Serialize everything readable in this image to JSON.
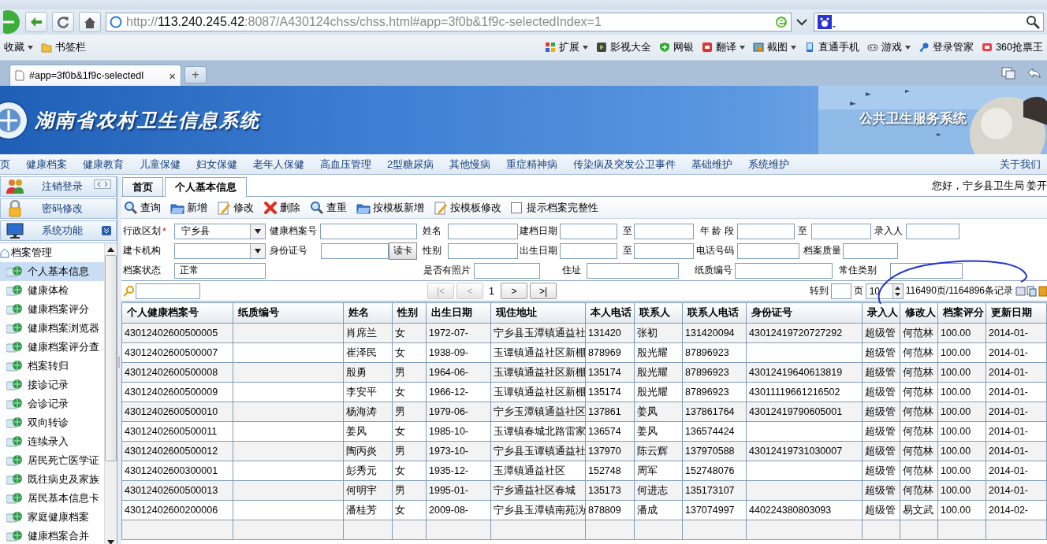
{
  "browser": {
    "url_prefix": "http://",
    "url_host": "113.240.245.42",
    "url_rest": ":8087/A430124chss/chss.html#app=3f0b&1f9c-selectedIndex=1",
    "bookmarks_left": [
      {
        "label": "收藏",
        "menu": true
      },
      {
        "label": "书签栏",
        "kind": "folder",
        "menu": false
      }
    ],
    "bookmarks_right": [
      {
        "label": "扩展",
        "kind": "grid",
        "menu": true
      },
      {
        "label": "影视大全",
        "kind": "film",
        "menu": false
      },
      {
        "label": "网银",
        "kind": "shield",
        "menu": false
      },
      {
        "label": "翻译",
        "kind": "translate",
        "menu": true
      },
      {
        "label": "截图",
        "kind": "scissors",
        "menu": true
      },
      {
        "label": "直通手机",
        "kind": "phone",
        "menu": false
      },
      {
        "label": "游戏",
        "kind": "gamepad",
        "menu": true
      },
      {
        "label": "登录管家",
        "kind": "key",
        "menu": false
      },
      {
        "label": "360抢票王",
        "kind": "ticket",
        "menu": false
      }
    ],
    "tab": {
      "title": "#app=3f0b&1f9c-selectedI",
      "close": "×"
    },
    "new_tab": "+"
  },
  "header": {
    "title": "湖南省农村卫生信息系统",
    "subtitle": "公共卫生服务系统"
  },
  "menu": {
    "items": [
      "页",
      "健康档案",
      "健康教育",
      "儿童保健",
      "妇女保健",
      "老年人保健",
      "高血压管理",
      "2型糖尿病",
      "其他慢病",
      "重症精神病",
      "传染病及突发公卫事件",
      "基础维护",
      "系统维护"
    ],
    "right": "关于我们"
  },
  "sidebar": {
    "buttons": [
      {
        "label": "注销登录",
        "kind": "people"
      },
      {
        "label": "密码修改",
        "kind": "lock"
      },
      {
        "label": "系统功能",
        "kind": "monitor"
      }
    ],
    "tree": [
      {
        "label": "档案管理",
        "expanded": true,
        "children": [
          {
            "label": "个人基本信息",
            "selected": true
          },
          {
            "label": "健康体检",
            "selected": false
          },
          {
            "label": "健康档案评分",
            "selected": false
          },
          {
            "label": "健康档案浏览器",
            "selected": false
          },
          {
            "label": "健康档案评分查",
            "selected": false
          },
          {
            "label": "档案转归",
            "selected": false
          },
          {
            "label": "接诊记录",
            "selected": false
          },
          {
            "label": "会诊记录",
            "selected": false
          },
          {
            "label": "双向转诊",
            "selected": false
          },
          {
            "label": "连续录入",
            "selected": false
          },
          {
            "label": "居民死亡医学证",
            "selected": false
          },
          {
            "label": "既往病史及家族",
            "selected": false
          },
          {
            "label": "居民基本信息卡",
            "selected": false
          },
          {
            "label": "家庭健康档案",
            "selected": false
          },
          {
            "label": "健康档案合并",
            "selected": false
          }
        ]
      }
    ]
  },
  "tabs": [
    {
      "label": "首页",
      "selected": false
    },
    {
      "label": "个人基本信息",
      "selected": true
    }
  ],
  "greeting": "您好，宁乡县卫生局  姜开",
  "toolbar": [
    {
      "label": "查询",
      "kind": "search"
    },
    {
      "label": "新增",
      "kind": "folder"
    },
    {
      "label": "修改",
      "kind": "note"
    },
    {
      "label": "删除",
      "kind": "delete"
    },
    {
      "label": "查重",
      "kind": "search"
    },
    {
      "label": "按模板新增",
      "kind": "folder"
    },
    {
      "label": "按模板修改",
      "kind": "note"
    }
  ],
  "completeness": {
    "label": "提示档案完整性",
    "checked": false
  },
  "form": {
    "fields": [
      {
        "label": "行政区划",
        "required_mark": "*",
        "kind": "select",
        "value": "宁乡县"
      },
      {
        "label": "健康档案号",
        "kind": "input"
      },
      {
        "label": "姓名",
        "kind": "input"
      },
      {
        "label": "建档日期",
        "kind": "range",
        "separator": "至"
      },
      {
        "label": "年 龄 段",
        "kind": "range",
        "separator": "至"
      },
      {
        "label": "录入人",
        "kind": "input"
      },
      {
        "label": "建卡机构",
        "kind": "select"
      },
      {
        "label": "身份证号",
        "kind": "input",
        "button": "读卡"
      },
      {
        "label": "性别",
        "kind": "input"
      },
      {
        "label": "出生日期",
        "kind": "range",
        "separator": "至"
      },
      {
        "label": "电话号码",
        "kind": "input"
      },
      {
        "label": "档案质量",
        "kind": "input"
      },
      {
        "label": "档案状态",
        "kind": "input",
        "value": "正常"
      },
      {
        "label": "是否有照片",
        "kind": "input"
      },
      {
        "label": "住址",
        "kind": "input"
      },
      {
        "label": "纸质编号",
        "kind": "input"
      },
      {
        "label": "常住类别",
        "kind": "input"
      }
    ]
  },
  "pager": {
    "buttons": [
      {
        "text": "|<",
        "disabled": true
      },
      {
        "text": "<",
        "disabled": true
      },
      {
        "text": "1",
        "kind": "current"
      },
      {
        "text": ">",
        "disabled": false
      },
      {
        "text": ">|",
        "disabled": false
      }
    ],
    "goto_label": "转到",
    "page_unit": "页",
    "page_size": "10",
    "summary": "116490页/1164896条记录"
  },
  "table": {
    "columns": [
      "个人健康档案号",
      "纸质编号",
      "姓名",
      "性别",
      "出生日期",
      "现住地址",
      "本人电话",
      "联系人",
      "联系人电话",
      "身份证号",
      "录入人",
      "修改人",
      "档案评分",
      "更新日期"
    ],
    "rows": [
      [
        "43012402600500005",
        "",
        "肖席兰",
        "女",
        "1972-07-",
        "宁乡县玉潭镇通益社",
        "131420",
        "张初",
        "131420094",
        "43012419720727292",
        "超级管",
        "何范林",
        "100.00",
        "2014-01-"
      ],
      [
        "43012402600500007",
        "",
        "崔泽民",
        "女",
        "1938-09-",
        "玉谭镇通益社区新棚",
        "878969",
        "殷光耀",
        "87896923",
        "",
        "超级管",
        "何范林",
        "100.00",
        "2014-01-"
      ],
      [
        "43012402600500008",
        "",
        "殷勇",
        "男",
        "1964-06-",
        "玉谭镇通益社区新棚",
        "135174",
        "殷光耀",
        "87896923",
        "43012419640613819",
        "超级管",
        "何范林",
        "100.00",
        "2014-01-"
      ],
      [
        "43012402600500009",
        "",
        "李安平",
        "女",
        "1966-12-",
        "玉谭镇通益社区新棚",
        "135174",
        "殷光耀",
        "87896923",
        "43011119661216502",
        "超级管",
        "何范林",
        "100.00",
        "2014-01-"
      ],
      [
        "43012402600500010",
        "",
        "杨海涛",
        "男",
        "1979-06-",
        "宁乡玉潭镇通益社区",
        "137861",
        "姜凤",
        "137861764",
        "43012419790605001",
        "超级管",
        "何范林",
        "100.00",
        "2014-01-"
      ],
      [
        "43012402600500011",
        "",
        "姜风",
        "女",
        "1985-10-",
        "玉谭镇春城北路雷家",
        "136574",
        "姜风",
        "136574424",
        "",
        "超级管",
        "何范林",
        "100.00",
        "2014-01-"
      ],
      [
        "43012402600500012",
        "",
        "陶丙炎",
        "男",
        "1973-10-",
        "宁乡县玉谭镇通益社",
        "137970",
        "陈云辉",
        "137970588",
        "43012419731030007",
        "超级管",
        "何范林",
        "100.00",
        "2014-01-"
      ],
      [
        "43012402600300001",
        "",
        "彭秀元",
        "女",
        "1935-12-",
        "玉潭镇通益社区",
        "152748",
        "周军",
        "152748076",
        "",
        "超级管",
        "何范林",
        "100.00",
        "2014-01-"
      ],
      [
        "43012402600500013",
        "",
        "何明宇",
        "男",
        "1995-01-",
        "宁乡通益社区春城",
        "135173",
        "何进志",
        "135173107",
        "",
        "超级管",
        "何范林",
        "100.00",
        "2014-01-"
      ],
      [
        "43012402600200006",
        "",
        "潘桂芳",
        "女",
        "2009-08-",
        "宁乡县玉潭镇南苑沩",
        "878809",
        "潘成",
        "137074997",
        "440224380803093",
        "超级管",
        "易文武",
        "100.00",
        "2014-02-"
      ]
    ]
  }
}
